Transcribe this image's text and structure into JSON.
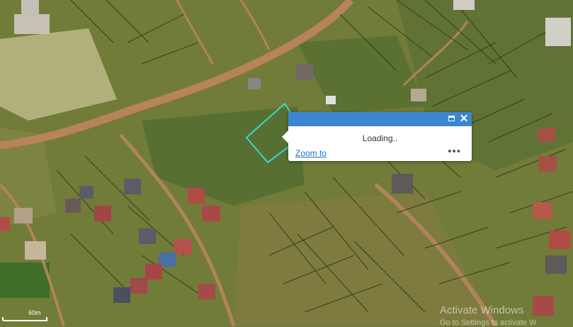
{
  "popup": {
    "loading_text": "Loading..",
    "zoom_link": "Zoom to",
    "more_label": "•••",
    "close_label": "✕"
  },
  "scale": {
    "label": "60m"
  },
  "watermark": {
    "line1": "Activate Windows",
    "line2": "Go to Settings to activate W"
  },
  "colors": {
    "popup_header": "#3b86d2",
    "selection_outline": "#35d9d0",
    "parcel_lines": "#2b3318",
    "road": "#b7835a"
  }
}
